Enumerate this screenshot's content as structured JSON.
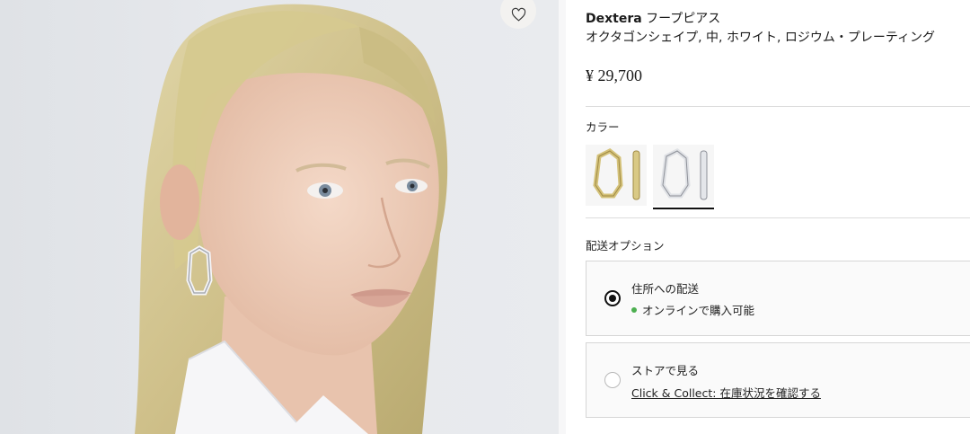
{
  "product": {
    "brand": "Dextera",
    "type": "フープピアス",
    "subtitle": "オクタゴンシェイプ, 中, ホワイト, ロジウム・プレーティング",
    "price": "¥ 29,700"
  },
  "color": {
    "label": "カラー",
    "swatches": [
      {
        "name": "gold-tone",
        "accent": "#c9b36a"
      },
      {
        "name": "rhodium",
        "accent": "#a9acb3",
        "selected": true
      }
    ]
  },
  "delivery": {
    "label": "配送オプション",
    "options": [
      {
        "title": "住所への配送",
        "status": "オンラインで購入可能",
        "status_color": "#4caf50",
        "selected": true
      },
      {
        "title": "ストアで見る",
        "link_text": "Click & Collect: 在庫状況を確認する",
        "selected": false
      }
    ]
  },
  "icons": {
    "wishlist": "heart-icon"
  }
}
